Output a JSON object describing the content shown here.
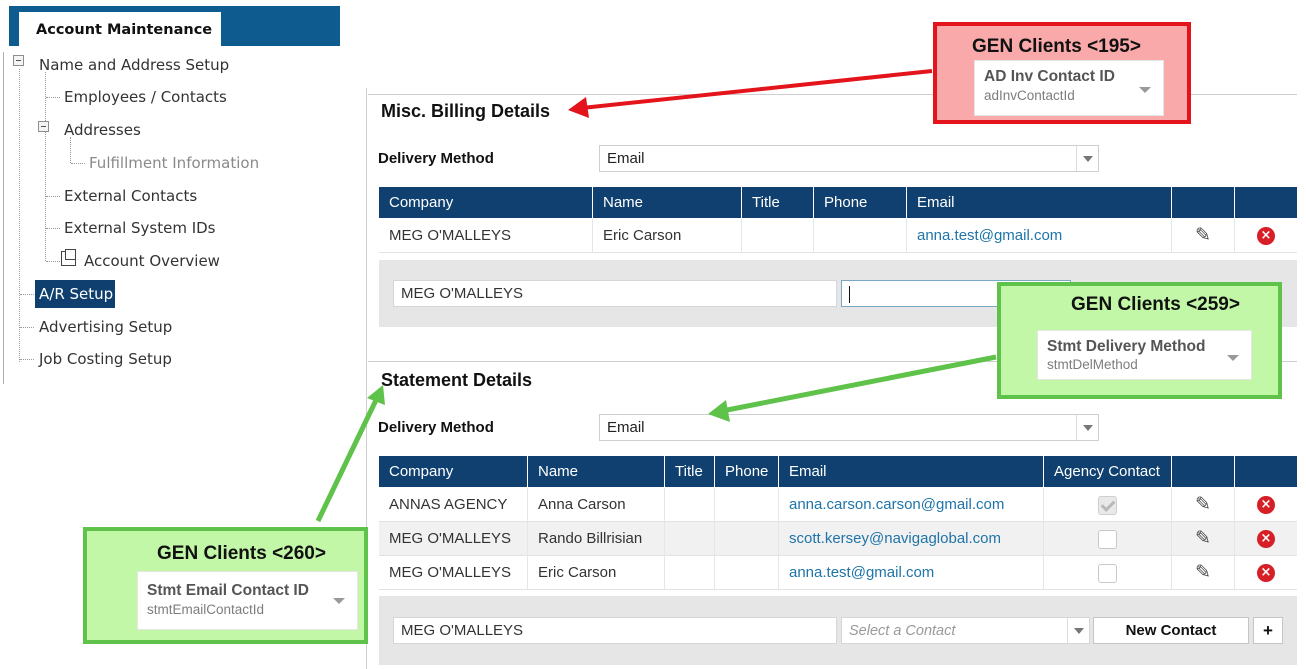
{
  "nav": {
    "tab_label": "Account Maintenance",
    "items": [
      {
        "label": "Name and Address Setup"
      },
      {
        "label": "Employees / Contacts"
      },
      {
        "label": "Addresses"
      },
      {
        "label": "Fulfillment Information"
      },
      {
        "label": "External Contacts"
      },
      {
        "label": "External System IDs"
      },
      {
        "label": "Account Overview"
      },
      {
        "label": "A/R Setup"
      },
      {
        "label": "Advertising Setup"
      },
      {
        "label": "Job Costing Setup"
      }
    ],
    "selected": "A/R Setup"
  },
  "misc_billing": {
    "title": "Misc. Billing Details",
    "delivery_label": "Delivery Method",
    "delivery_value": "Email",
    "columns": [
      "Company",
      "Name",
      "Title",
      "Phone",
      "Email"
    ],
    "rows": [
      {
        "company": "MEG O'MALLEYS",
        "name": "Eric Carson",
        "title": "",
        "phone": "",
        "email": "anna.test@gmail.com"
      }
    ],
    "add_row": {
      "company_value": "MEG O'MALLEYS",
      "contact_value": ""
    }
  },
  "statement": {
    "title": "Statement Details",
    "delivery_label": "Delivery Method",
    "delivery_value": "Email",
    "columns": [
      "Company",
      "Name",
      "Title",
      "Phone",
      "Email",
      "Agency Contact"
    ],
    "rows": [
      {
        "company": "ANNAS AGENCY",
        "name": "Anna Carson",
        "title": "",
        "phone": "",
        "email": "anna.carson.carson@gmail.com",
        "agency_contact": true
      },
      {
        "company": "MEG O'MALLEYS",
        "name": "Rando Billrisian",
        "title": "",
        "phone": "",
        "email": "scott.kersey@navigaglobal.com",
        "agency_contact": false
      },
      {
        "company": "MEG O'MALLEYS",
        "name": "Eric Carson",
        "title": "",
        "phone": "",
        "email": "anna.test@gmail.com",
        "agency_contact": false
      }
    ],
    "add_row": {
      "company_value": "MEG O'MALLEYS",
      "contact_placeholder": "Select a Contact",
      "new_contact_label": "New Contact",
      "plus_label": "+"
    }
  },
  "callouts": [
    {
      "title": "GEN Clients <195>",
      "field_label": "AD Inv Contact ID",
      "field_id": "adInvContactId",
      "color": "#e3141b"
    },
    {
      "title": "GEN Clients <259>",
      "field_label": "Stmt Delivery Method",
      "field_id": "stmtDelMethod",
      "color": "#5fc24a"
    },
    {
      "title": "GEN Clients <260>",
      "field_label": "Stmt Email Contact ID",
      "field_id": "stmtEmailContactId",
      "color": "#5fc24a"
    }
  ],
  "icons": {
    "edit": "pencil-icon",
    "delete": "delete-circle-icon",
    "dropdown": "chevron-down-icon",
    "tree_expander": "minus-box-icon",
    "external": "external-link-icon"
  }
}
